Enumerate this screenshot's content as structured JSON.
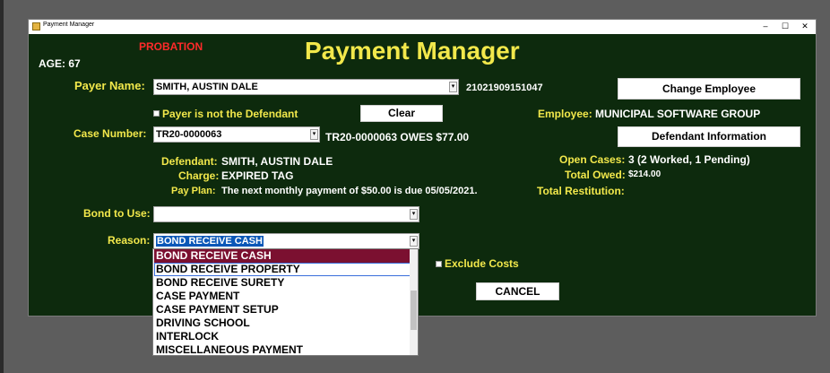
{
  "window": {
    "title": "Payment Manager",
    "minimize": "–",
    "maximize": "☐",
    "close": "✕"
  },
  "header": {
    "status_badge": "PROBATION",
    "age": "AGE: 67",
    "title": "Payment Manager"
  },
  "payer": {
    "label": "Payer Name:",
    "value": "SMITH, AUSTIN DALE",
    "id": "21021909151047",
    "not_defendant_label": "Payer is not the Defendant"
  },
  "buttons": {
    "change_employee": "Change Employee",
    "clear": "Clear",
    "defendant_information": "Defendant Information",
    "cancel": "CANCEL"
  },
  "employee": {
    "label": "Employee:",
    "value": "MUNICIPAL SOFTWARE GROUP"
  },
  "case": {
    "label": "Case Number:",
    "value": "TR20-0000063",
    "owes_text": "TR20-0000063 OWES $77.00"
  },
  "details": {
    "defendant_label": "Defendant:",
    "defendant_value": "SMITH, AUSTIN DALE",
    "charge_label": "Charge:",
    "charge_value": "EXPIRED TAG",
    "pay_plan_label": "Pay Plan:",
    "pay_plan_value": "The next monthly payment of $50.00 is due 05/05/2021."
  },
  "summary": {
    "open_cases_label": "Open Cases:",
    "open_cases_value": "3 (2 Worked, 1 Pending)",
    "total_owed_label": "Total Owed:",
    "total_owed_value": "$214.00",
    "total_restitution_label": "Total Restitution:"
  },
  "bond": {
    "label": "Bond to Use:",
    "value": ""
  },
  "reason": {
    "label": "Reason:",
    "value": "BOND RECEIVE CASH",
    "options": [
      "BOND RECEIVE CASH",
      "BOND RECEIVE PROPERTY",
      "BOND RECEIVE SURETY",
      "CASE PAYMENT",
      "CASE PAYMENT SETUP",
      "DRIVING SCHOOL",
      "INTERLOCK",
      "MISCELLANEOUS PAYMENT"
    ]
  },
  "exclude_costs": {
    "label": "Exclude Costs"
  },
  "colors": {
    "background": "#0d2a0d",
    "label": "#f2e84b",
    "status": "#ff2a2a",
    "selection": "#7b1030"
  }
}
